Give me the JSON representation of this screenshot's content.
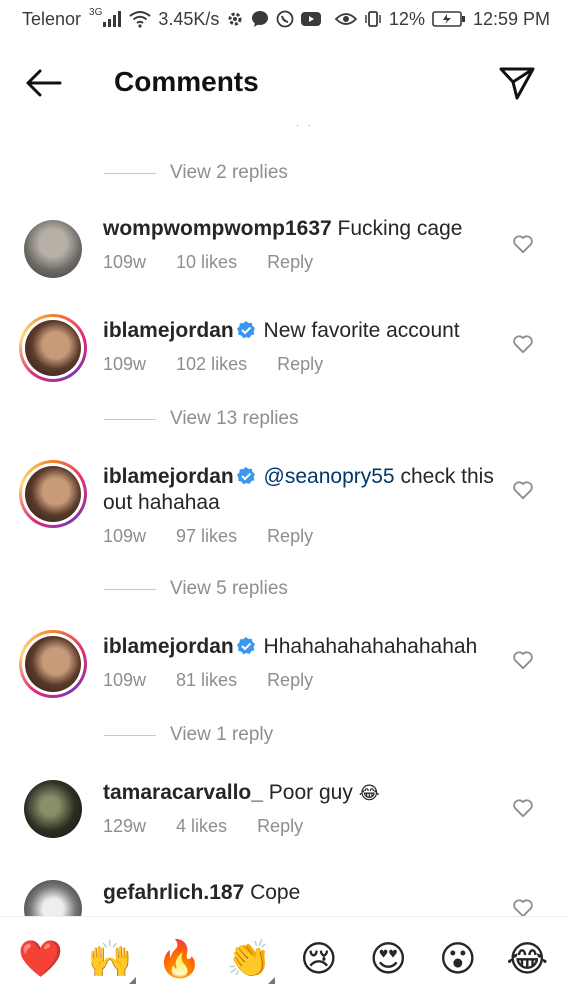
{
  "status_bar": {
    "carrier": "Telenor",
    "network": "3G",
    "speed": "3.45K/s",
    "battery": "12%",
    "time": "12:59 PM",
    "icons": [
      "signal-icon",
      "wifi-icon",
      "settings-icon",
      "chat-icon",
      "whatsapp-icon",
      "youtube-icon",
      "eye-icon",
      "vibrate-icon",
      "battery-icon"
    ]
  },
  "header": {
    "title": "Comments",
    "back_icon": "arrow-left-icon",
    "share_icon": "paper-plane-icon"
  },
  "comments": [
    {
      "type": "view_replies",
      "label": "View 2 replies"
    },
    {
      "type": "comment",
      "username": "wompwompwomp1637",
      "verified": false,
      "text": "Fucking cage",
      "time": "109w",
      "likes": "10 likes",
      "reply": "Reply",
      "ring": false
    },
    {
      "type": "comment",
      "username": "iblamejordan",
      "verified": true,
      "text": "New favorite account",
      "time": "109w",
      "likes": "102 likes",
      "reply": "Reply",
      "ring": true
    },
    {
      "type": "view_replies",
      "label": "View 13 replies"
    },
    {
      "type": "comment",
      "username": "iblamejordan",
      "verified": true,
      "mention": "@seanopry55",
      "text": " check this out hahahaa",
      "time": "109w",
      "likes": "97 likes",
      "reply": "Reply",
      "ring": true
    },
    {
      "type": "view_replies",
      "label": "View 5 replies"
    },
    {
      "type": "comment",
      "username": "iblamejordan",
      "verified": true,
      "text": "Hhahahahahahahahah",
      "time": "109w",
      "likes": "81 likes",
      "reply": "Reply",
      "ring": true
    },
    {
      "type": "view_replies",
      "label": "View 1 reply"
    },
    {
      "type": "comment",
      "username": "tamaracarvallo_",
      "verified": false,
      "text": "Poor guy",
      "emoji": "😂",
      "time": "129w",
      "likes": "4 likes",
      "reply": "Reply",
      "ring": false
    },
    {
      "type": "comment",
      "username": "gefahrlich.187",
      "verified": false,
      "text": "Cope",
      "ring": false
    }
  ],
  "emoji_bar": [
    {
      "emoji": "❤️",
      "name": "red-heart"
    },
    {
      "emoji": "🙌",
      "name": "raising-hands"
    },
    {
      "emoji": "🔥",
      "name": "fire"
    },
    {
      "emoji": "👏",
      "name": "clapping-hands"
    },
    {
      "emoji": "😢",
      "name": "crying-face"
    },
    {
      "emoji": "😍",
      "name": "heart-eyes"
    },
    {
      "emoji": "😮",
      "name": "surprised-face"
    },
    {
      "emoji": "😂",
      "name": "tears-of-joy"
    }
  ]
}
